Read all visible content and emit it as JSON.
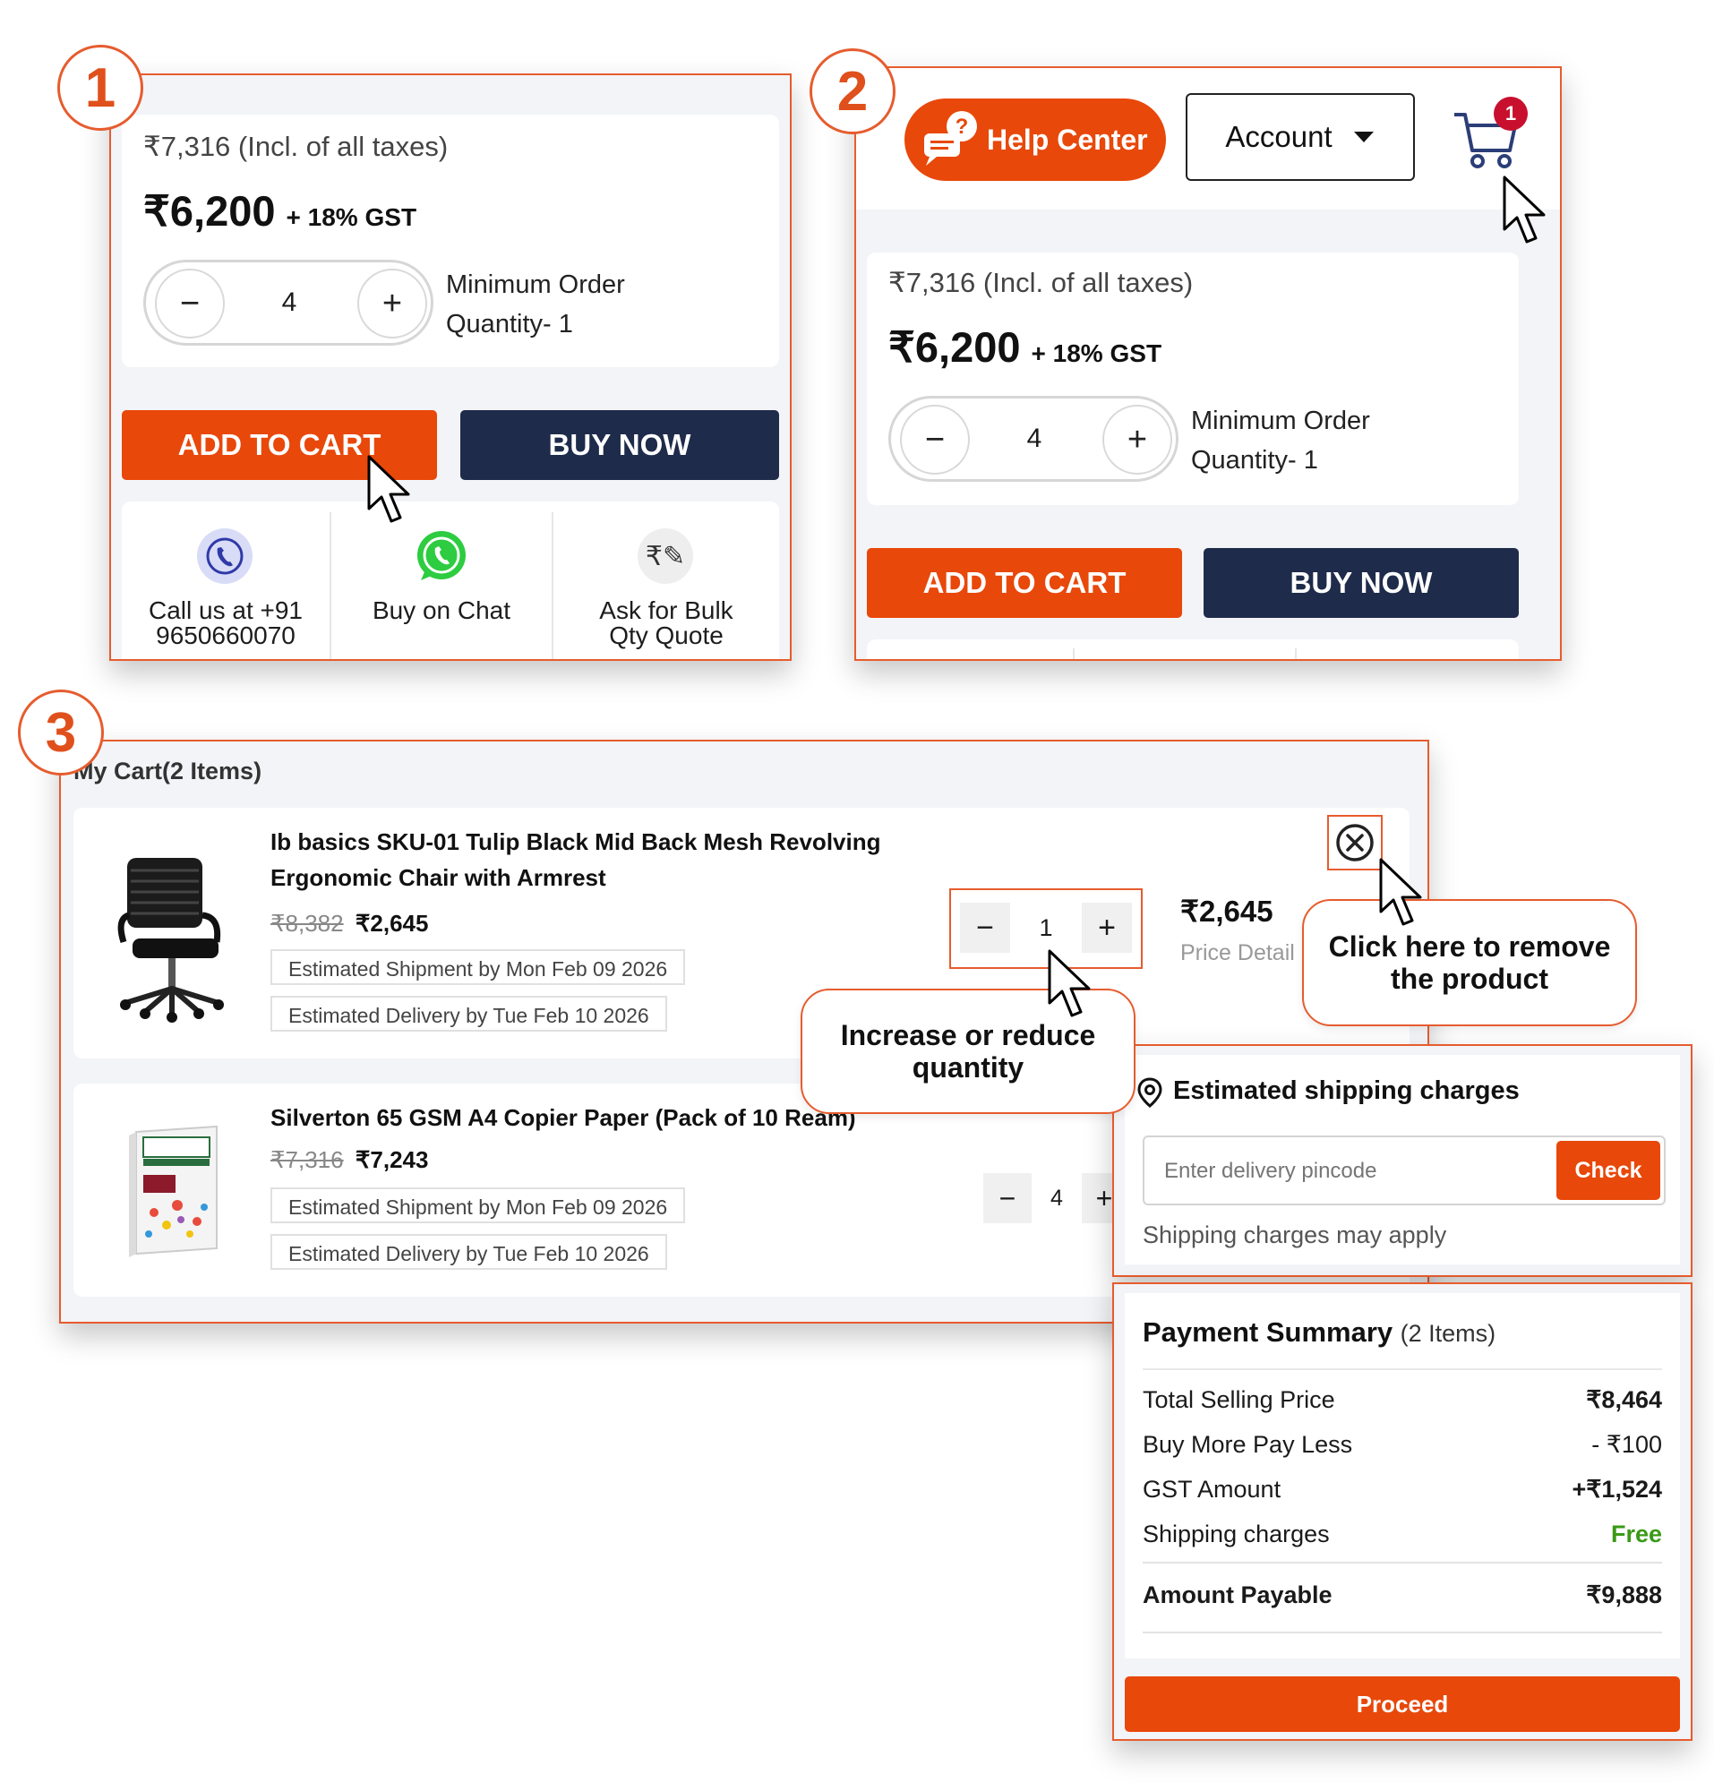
{
  "steps": [
    "1",
    "2",
    "3"
  ],
  "product": {
    "price_incl": "₹7,316 (Incl. of all taxes)",
    "price": "₹6,200",
    "gst": "+ 18% GST",
    "quantity": "4",
    "moq_line1": "Minimum Order",
    "moq_line2": "Quantity- 1",
    "add_to_cart": "ADD TO CART",
    "buy_now": "BUY NOW",
    "contact": {
      "call_line1": "Call us at +91",
      "call_line2": "9650660070",
      "chat": "Buy on Chat",
      "bulk_line1": "Ask for Bulk",
      "bulk_line2": "Qty Quote"
    }
  },
  "header": {
    "help_center": "Help Center",
    "account": "Account",
    "cart_count": "1"
  },
  "cart": {
    "title": "My Cart(2 Items)",
    "items": [
      {
        "name_line1": "Ib basics SKU-01 Tulip Black Mid Back Mesh Revolving",
        "name_line2": "Ergonomic Chair with Armrest",
        "mrp": "₹8,382",
        "price": "₹2,645",
        "shipment": "Estimated Shipment by Mon Feb 09 2026",
        "delivery": "Estimated Delivery by Tue Feb 10 2026",
        "quantity": "1",
        "total": "₹2,645",
        "price_detail": "Price Detail"
      },
      {
        "name_line1": "Silverton 65 GSM A4 Copier Paper (Pack of 10 Ream)",
        "mrp": "₹7,316",
        "price": "₹7,243",
        "shipment": "Estimated Shipment by Mon Feb 09 2026",
        "delivery": "Estimated Delivery by Tue Feb 10 2026",
        "quantity": "4"
      }
    ]
  },
  "callouts": {
    "quantity_line1": "Increase or reduce",
    "quantity_line2": "quantity",
    "remove_line1": "Click here to remove",
    "remove_line2": "the product"
  },
  "shipping": {
    "title": "Estimated shipping charges",
    "placeholder": "Enter delivery pincode",
    "check": "Check",
    "note": "Shipping charges may apply"
  },
  "summary": {
    "title": "Payment Summary",
    "count": "(2 Items)",
    "rows": [
      {
        "label": "Total Selling Price",
        "value": "₹8,464"
      },
      {
        "label": "Buy More Pay Less",
        "value": "- ₹100"
      },
      {
        "label": "GST Amount",
        "value": "+₹1,524"
      },
      {
        "label": "Shipping charges",
        "value": "Free"
      }
    ],
    "payable_label": "Amount Payable",
    "payable_value": "₹9,888",
    "proceed": "Proceed"
  },
  "colors": {
    "accent": "#e8480a",
    "navy": "#1e2b4a",
    "free": "#3a9a17",
    "badge": "#c8102e"
  }
}
